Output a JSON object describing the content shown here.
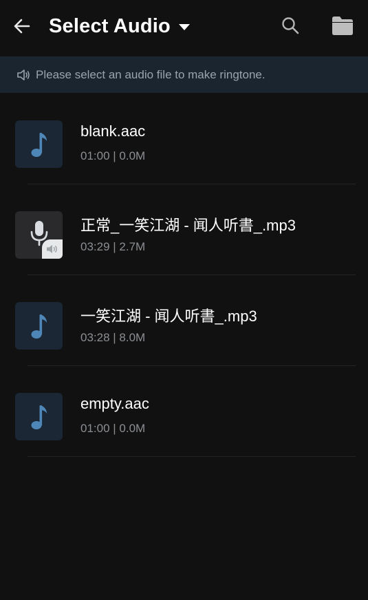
{
  "header": {
    "title": "Select Audio",
    "icons": {
      "back": "arrow-left-icon",
      "dropdown": "caret-down-icon",
      "search": "search-icon",
      "folder": "folder-icon"
    }
  },
  "notice": {
    "text": "Please select an audio file to make ringtone.",
    "icon": "speaker-icon"
  },
  "files": [
    {
      "name": "blank.aac",
      "duration": "01:00",
      "size": "0.0M",
      "icon": "music-note-icon"
    },
    {
      "name": "正常_一笑江湖 - 闻人听書_.mp3",
      "duration": "03:29",
      "size": "2.7M",
      "icon": "microphone-icon"
    },
    {
      "name": "一笑江湖 - 闻人听書_.mp3",
      "duration": "03:28",
      "size": "8.0M",
      "icon": "music-note-icon"
    },
    {
      "name": "empty.aac",
      "duration": "01:00",
      "size": "0.0M",
      "icon": "music-note-icon"
    }
  ],
  "colors": {
    "background": "#111111",
    "notice_bg": "#1a2530",
    "accent_blue": "#4f86b8",
    "meta_text": "#8b8f93"
  }
}
